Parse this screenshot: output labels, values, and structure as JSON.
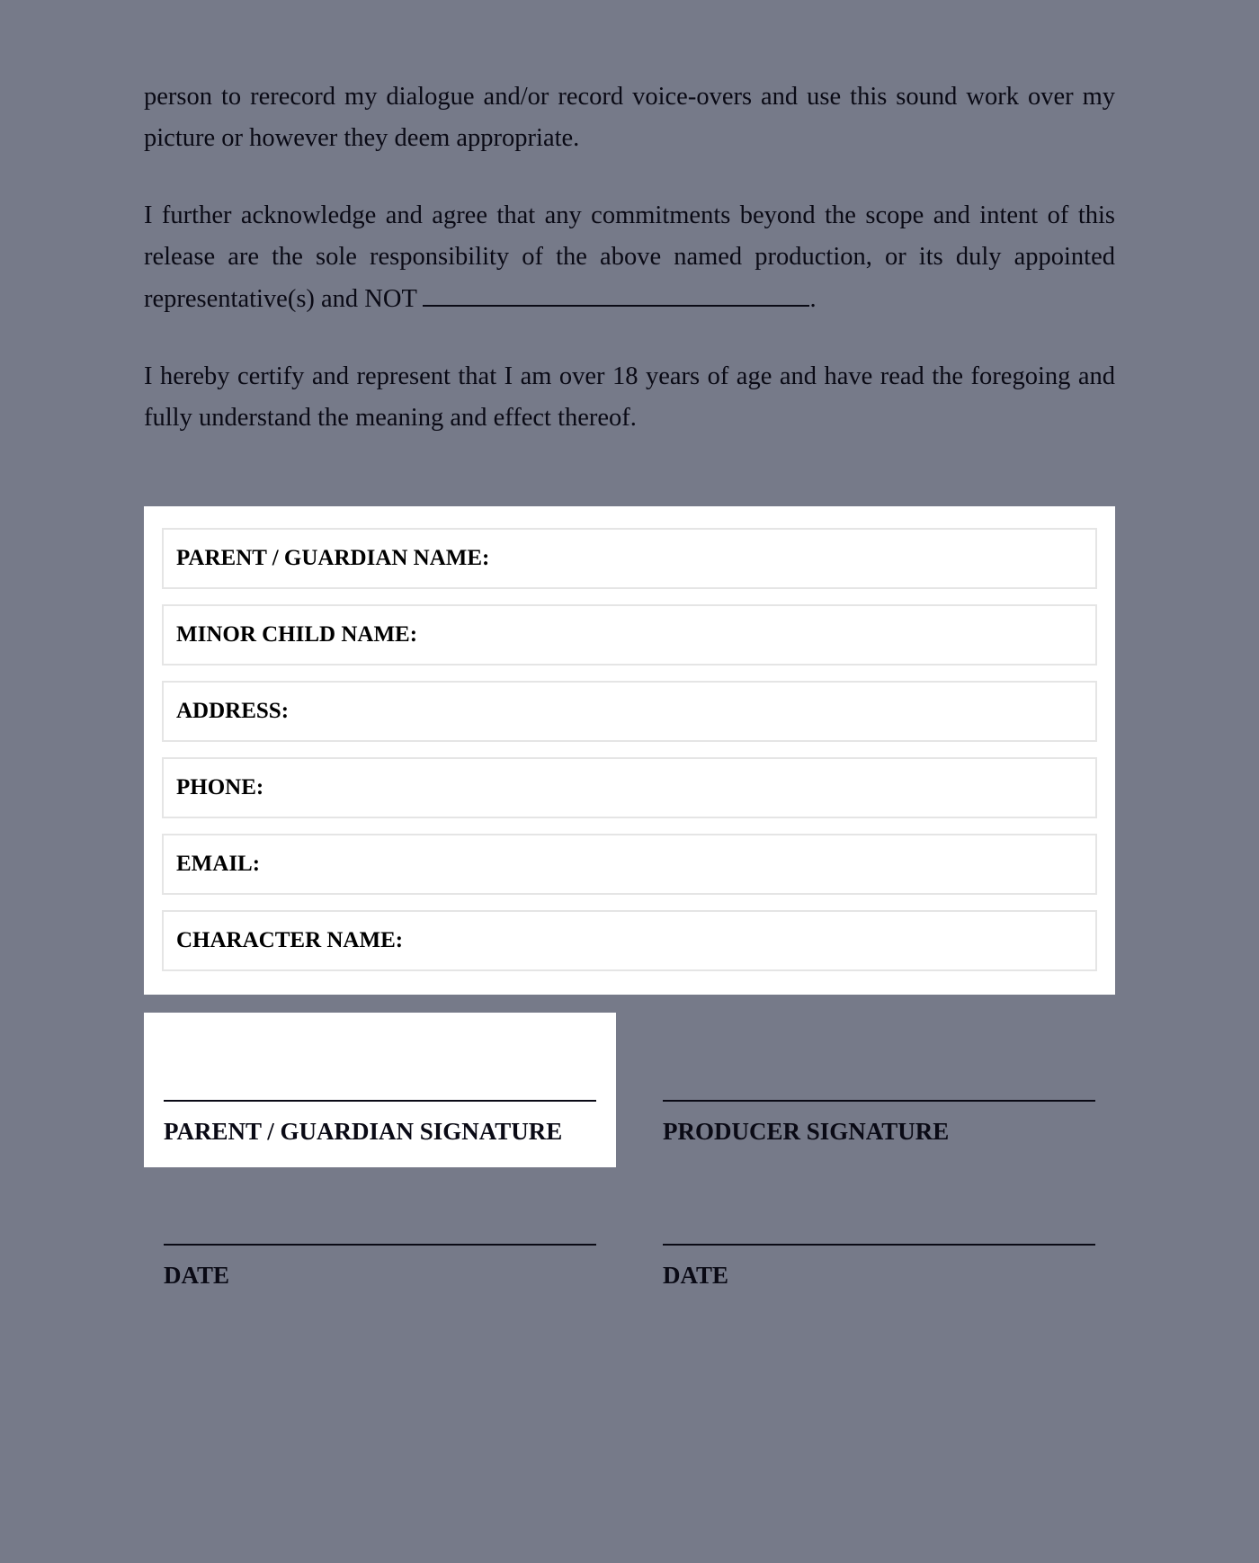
{
  "paragraphs": {
    "p1": "person to rerecord my dialogue and/or record voice-overs and use this sound work over my picture or however they deem appropriate.",
    "p2_pre": "I further acknowledge and agree that any commitments beyond the scope and intent of this release are the sole responsibility of the above named production, or its duly appointed representative(s) and NOT ",
    "p2_post": ".",
    "p3": "I hereby certify and represent that I am over 18 years of age and have read the foregoing and fully under­stand the meaning and effect thereof."
  },
  "form": {
    "fields": [
      "PARENT / GUARDIAN NAME:",
      "MINOR CHILD NAME:",
      "ADDRESS:",
      "PHONE:",
      "EMAIL:",
      "CHARACTER NAME:"
    ]
  },
  "signatures": {
    "parent_sig": "PARENT / GUARDIAN SIGNATURE",
    "producer_sig": "PRODUCER SIGNATURE",
    "date1": "DATE",
    "date2": "DATE"
  }
}
